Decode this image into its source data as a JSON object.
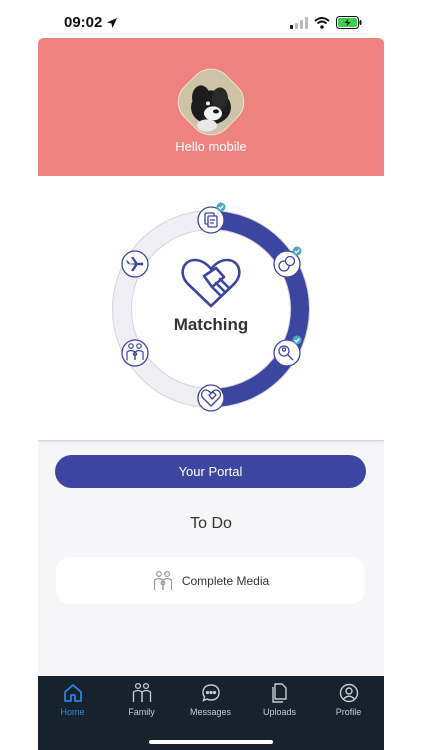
{
  "status_bar": {
    "time": "09:02"
  },
  "header": {
    "greeting": "Hello mobile",
    "color": "#ee827e"
  },
  "progress": {
    "center_label": "Matching",
    "completed_color": "#3c45a0",
    "remaining_color": "#ededf3",
    "check_color": "#4aa8c8",
    "steps": [
      {
        "icon": "document-icon",
        "completed": true
      },
      {
        "icon": "chat-bubbles-icon",
        "completed": true
      },
      {
        "icon": "profile-search-icon",
        "completed": true
      },
      {
        "icon": "handshake-icon",
        "completed": false
      },
      {
        "icon": "family-icon",
        "completed": false
      },
      {
        "icon": "airplane-icon",
        "completed": false
      }
    ]
  },
  "portal_button": {
    "label": "Your Portal"
  },
  "todo": {
    "title": "To Do",
    "items": [
      {
        "icon": "family-icon",
        "label": "Complete Media"
      }
    ]
  },
  "tab_bar": {
    "active_color": "#2f8bf0",
    "tabs": [
      {
        "label": "Home",
        "icon": "home-icon",
        "active": true
      },
      {
        "label": "Family",
        "icon": "family-icon",
        "active": false
      },
      {
        "label": "Messages",
        "icon": "messages-icon",
        "active": false
      },
      {
        "label": "Uploads",
        "icon": "uploads-icon",
        "active": false
      },
      {
        "label": "Profile",
        "icon": "profile-icon",
        "active": false
      }
    ]
  }
}
